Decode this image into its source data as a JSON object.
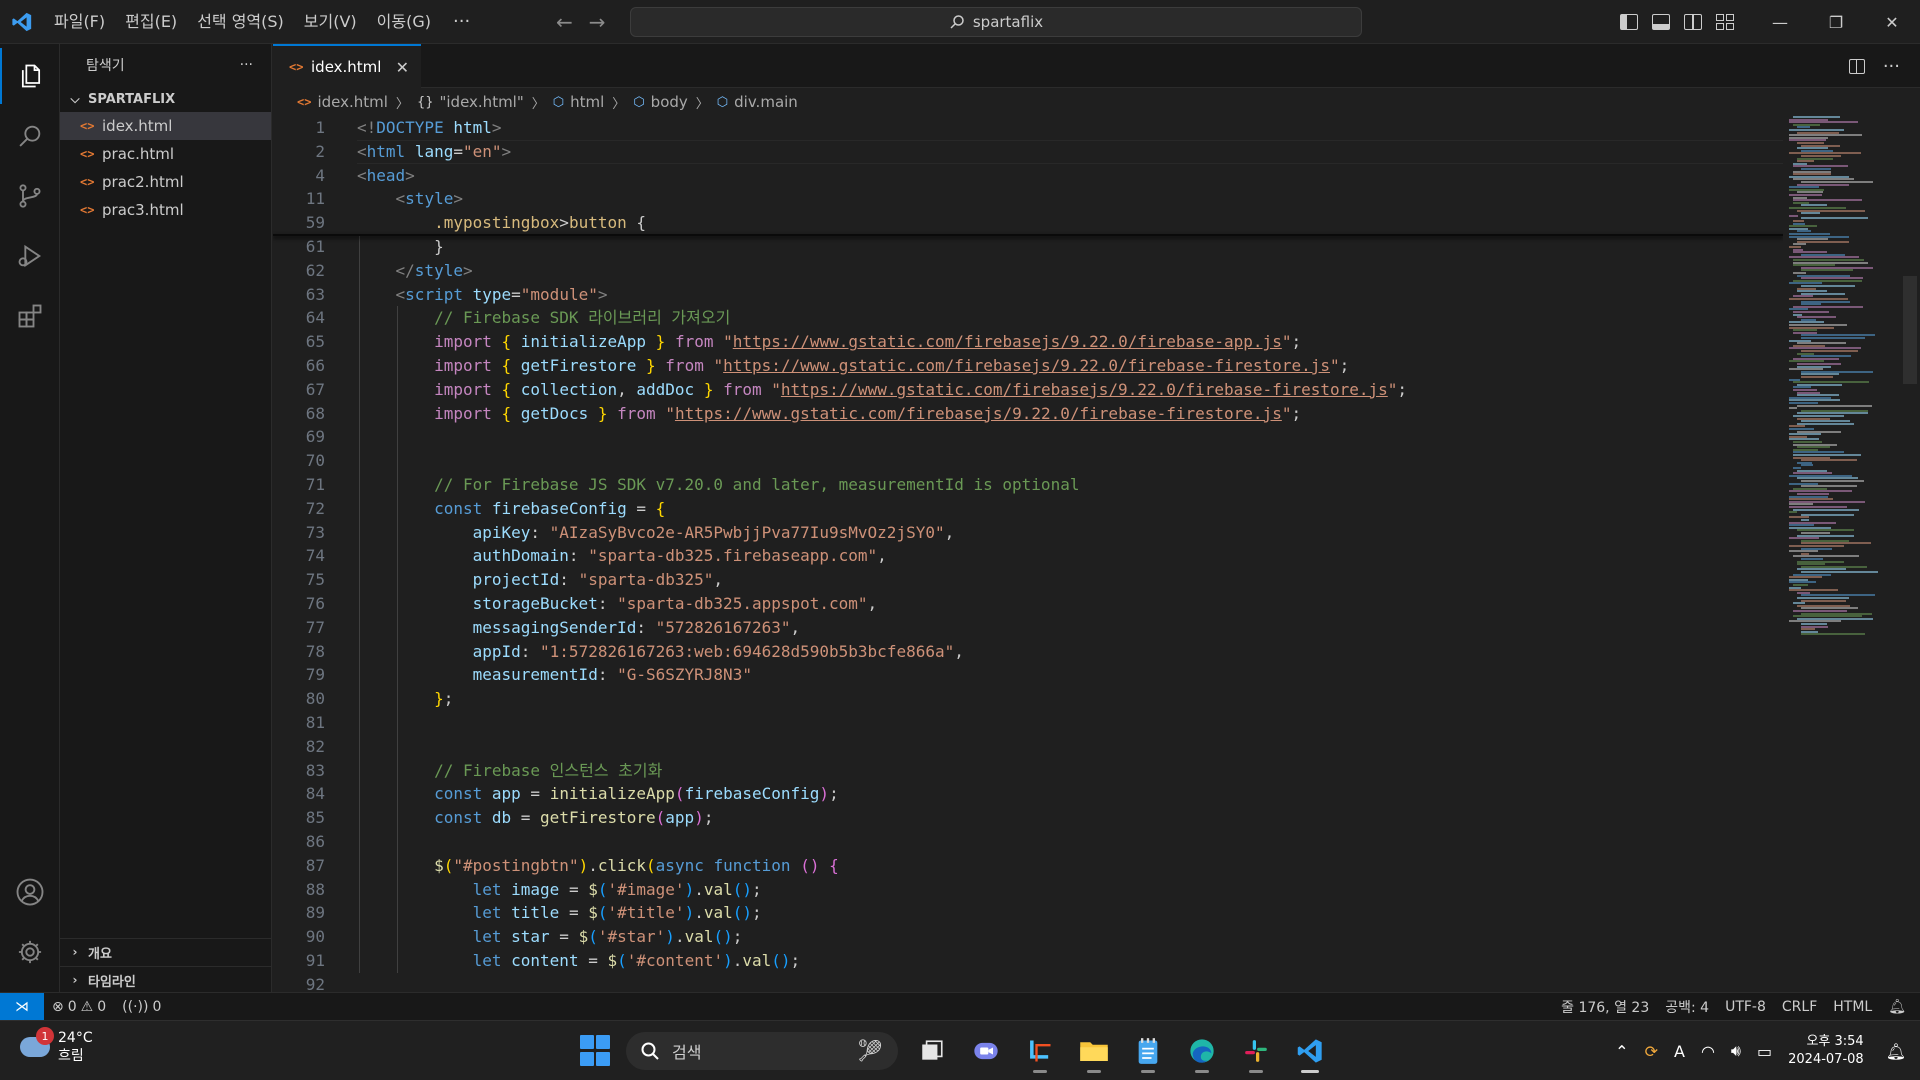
{
  "menubar": {
    "items": [
      "파일(F)",
      "편집(E)",
      "선택 영역(S)",
      "보기(V)",
      "이동(G)"
    ],
    "more": "···"
  },
  "command_center": {
    "text": "spartaflix"
  },
  "sidebar": {
    "title": "탐색기",
    "more": "···",
    "folder": "SPARTAFLIX",
    "files": [
      "idex.html",
      "prac.html",
      "prac2.html",
      "prac3.html"
    ],
    "bottom_sections": [
      "개요",
      "타임라인"
    ]
  },
  "tab": {
    "label": "idex.html"
  },
  "breadcrumb": [
    "idex.html",
    "\"idex.html\"",
    "html",
    "body",
    "div.main"
  ],
  "code_lines": [
    {
      "n": "1",
      "html": "<span class='t-tag'>&lt;!</span><span class='t-name'>DOCTYPE</span> <span class='t-attr'>html</span><span class='t-tag'>&gt;</span>"
    },
    {
      "n": "2",
      "html": "<span class='t-tag'>&lt;</span><span class='t-name'>html</span> <span class='t-attr'>lang</span>=<span class='t-str'>\"en\"</span><span class='t-tag'>&gt;</span>"
    },
    {
      "n": "4",
      "html": "<span class='t-tag'>&lt;</span><span class='t-name'>head</span><span class='t-tag'>&gt;</span>"
    },
    {
      "n": "11",
      "html": "    <span class='t-tag'>&lt;</span><span class='t-name'>style</span><span class='t-tag'>&gt;</span>"
    },
    {
      "n": "59",
      "html": "        <span class='t-sel'>.mypostingbox</span>&gt;<span class='t-sel'>button</span> {"
    },
    {
      "n": "61",
      "html": "        }"
    },
    {
      "n": "62",
      "html": "    <span class='t-tag'>&lt;/</span><span class='t-name'>style</span><span class='t-tag'>&gt;</span>"
    },
    {
      "n": "63",
      "html": "    <span class='t-tag'>&lt;</span><span class='t-name'>script</span> <span class='t-attr'>type</span>=<span class='t-str'>\"module\"</span><span class='t-tag'>&gt;</span>"
    },
    {
      "n": "64",
      "html": "        <span class='t-cmt'>// Firebase SDK 라이브러리 가져오기</span>"
    },
    {
      "n": "65",
      "html": "        <span class='t-kw'>import</span> <span class='t-brace'>{</span> <span class='t-var'>initializeApp</span> <span class='t-brace'>}</span> <span class='t-kw'>from</span> <span class='t-str'>\"</span><span class='t-url'>https://www.gstatic.com/firebasejs/9.22.0/firebase-app.js</span><span class='t-str'>\"</span>;"
    },
    {
      "n": "66",
      "html": "        <span class='t-kw'>import</span> <span class='t-brace'>{</span> <span class='t-var'>getFirestore</span> <span class='t-brace'>}</span> <span class='t-kw'>from</span> <span class='t-str'>\"</span><span class='t-url'>https://www.gstatic.com/firebasejs/9.22.0/firebase-firestore.js</span><span class='t-str'>\"</span>;"
    },
    {
      "n": "67",
      "html": "        <span class='t-kw'>import</span> <span class='t-brace'>{</span> <span class='t-var'>collection</span>, <span class='t-var'>addDoc</span> <span class='t-brace'>}</span> <span class='t-kw'>from</span> <span class='t-str'>\"</span><span class='t-url'>https://www.gstatic.com/firebasejs/9.22.0/firebase-firestore.js</span><span class='t-str'>\"</span>;"
    },
    {
      "n": "68",
      "html": "        <span class='t-kw'>import</span> <span class='t-brace'>{</span> <span class='t-var'>getDocs</span> <span class='t-brace'>}</span> <span class='t-kw'>from</span> <span class='t-str'>\"</span><span class='t-url'>https://www.gstatic.com/firebasejs/9.22.0/firebase-firestore.js</span><span class='t-str'>\"</span>;"
    },
    {
      "n": "69",
      "html": ""
    },
    {
      "n": "70",
      "html": ""
    },
    {
      "n": "71",
      "html": "        <span class='t-cmt'>// For Firebase JS SDK v7.20.0 and later, measurementId is optional</span>"
    },
    {
      "n": "72",
      "html": "        <span class='t-dec'>const</span> <span class='t-var'>firebaseConfig</span> = <span class='t-brace'>{</span>"
    },
    {
      "n": "73",
      "html": "            <span class='t-var'>apiKey</span>: <span class='t-str'>\"AIzaSyBvco2e-AR5PwbjjPva77Iu9sMvOz2jSY0\"</span>,"
    },
    {
      "n": "74",
      "html": "            <span class='t-var'>authDomain</span>: <span class='t-str'>\"sparta-db325.firebaseapp.com\"</span>,"
    },
    {
      "n": "75",
      "html": "            <span class='t-var'>projectId</span>: <span class='t-str'>\"sparta-db325\"</span>,"
    },
    {
      "n": "76",
      "html": "            <span class='t-var'>storageBucket</span>: <span class='t-str'>\"sparta-db325.appspot.com\"</span>,"
    },
    {
      "n": "77",
      "html": "            <span class='t-var'>messagingSenderId</span>: <span class='t-str'>\"572826167263\"</span>,"
    },
    {
      "n": "78",
      "html": "            <span class='t-var'>appId</span>: <span class='t-str'>\"1:572826167263:web:694628d590b5b3bcfe866a\"</span>,"
    },
    {
      "n": "79",
      "html": "            <span class='t-var'>measurementId</span>: <span class='t-str'>\"G-S6SZYRJ8N3\"</span>"
    },
    {
      "n": "80",
      "html": "        <span class='t-brace'>}</span>;"
    },
    {
      "n": "81",
      "html": ""
    },
    {
      "n": "82",
      "html": ""
    },
    {
      "n": "83",
      "html": "        <span class='t-cmt'>// Firebase 인스턴스 초기화</span>"
    },
    {
      "n": "84",
      "html": "        <span class='t-dec'>const</span> <span class='t-var'>app</span> = <span class='t-fn'>initializeApp</span><span class='t-br2'>(</span><span class='t-var'>firebaseConfig</span><span class='t-br2'>)</span>;"
    },
    {
      "n": "85",
      "html": "        <span class='t-dec'>const</span> <span class='t-var'>db</span> = <span class='t-fn'>getFirestore</span><span class='t-br2'>(</span><span class='t-var'>app</span><span class='t-br2'>)</span>;"
    },
    {
      "n": "86",
      "html": ""
    },
    {
      "n": "87",
      "html": "        <span class='t-fn'>$</span><span class='t-brace'>(</span><span class='t-str'>\"#postingbtn\"</span><span class='t-brace'>)</span>.<span class='t-fn'>click</span><span class='t-brace'>(</span><span class='t-dec'>async</span> <span class='t-dec'>function</span> <span class='t-br2'>()</span> <span class='t-br2'>{</span>"
    },
    {
      "n": "88",
      "html": "            <span class='t-dec'>let</span> <span class='t-var'>image</span> = <span class='t-fn'>$</span><span class='t-br3'>(</span><span class='t-str'>'#image'</span><span class='t-br3'>)</span>.<span class='t-fn'>val</span><span class='t-br3'>()</span>;"
    },
    {
      "n": "89",
      "html": "            <span class='t-dec'>let</span> <span class='t-var'>title</span> = <span class='t-fn'>$</span><span class='t-br3'>(</span><span class='t-str'>'#title'</span><span class='t-br3'>)</span>.<span class='t-fn'>val</span><span class='t-br3'>()</span>;"
    },
    {
      "n": "90",
      "html": "            <span class='t-dec'>let</span> <span class='t-var'>star</span> = <span class='t-fn'>$</span><span class='t-br3'>(</span><span class='t-str'>'#star'</span><span class='t-br3'>)</span>.<span class='t-fn'>val</span><span class='t-br3'>()</span>;"
    },
    {
      "n": "91",
      "html": "            <span class='t-dec'>let</span> <span class='t-var'>content</span> = <span class='t-fn'>$</span><span class='t-br3'>(</span><span class='t-str'>'#content'</span><span class='t-br3'>)</span>.<span class='t-fn'>val</span><span class='t-br3'>()</span>;"
    },
    {
      "n": "92",
      "html": ""
    }
  ],
  "statusbar": {
    "errors": "0",
    "warnings": "0",
    "ports": "0",
    "cursor": "줄 176, 열 23",
    "spaces": "공백: 4",
    "encoding": "UTF-8",
    "eol": "CRLF",
    "language": "HTML"
  },
  "taskbar": {
    "weather_badge": "1",
    "temperature": "24°C",
    "weather_desc": "흐림",
    "search_placeholder": "검색",
    "time": "오후 3:54",
    "date": "2024-07-08"
  },
  "colors": {
    "accent": "#0078d4",
    "editor_bg": "#1f1f1f",
    "sidebar_bg": "#181818"
  }
}
